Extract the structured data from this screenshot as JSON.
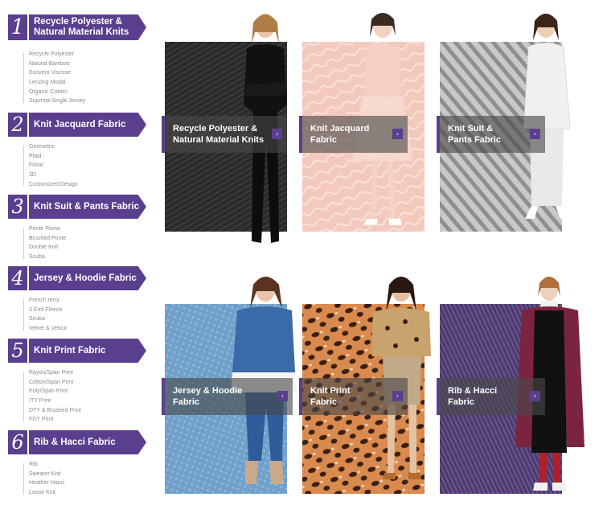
{
  "colors": {
    "accent": "#5a3f8e",
    "caption_bg": "rgba(72,72,72,0.62)"
  },
  "sidebar": {
    "categories": [
      {
        "num": "1",
        "title_line1": "Recycle Polyester &",
        "title_line2": "Natural Material Knits",
        "items": [
          "Recycle Polyester",
          "Natural Bamboo",
          "Ecovero Viscose",
          "Lenzing Modal",
          "Organic Cotton",
          "Suprima Single Jersey"
        ]
      },
      {
        "num": "2",
        "title_line1": "Knit Jacquard Fabric",
        "title_line2": "",
        "items": [
          "Geometric",
          "Plaid",
          "Floral",
          "3D",
          "Customized Design"
        ]
      },
      {
        "num": "3",
        "title_line1": "Knit Suit & Pants Fabric",
        "title_line2": "",
        "items": [
          "Ponte Roma",
          "Brushed Ponte",
          "Double Knit",
          "Scuba"
        ]
      },
      {
        "num": "4",
        "title_line1": "Jersey & Hoodie Fabric",
        "title_line2": "",
        "items": [
          "French terry",
          "3 End Fleece",
          "Scuba",
          "Velvet & Velour"
        ]
      },
      {
        "num": "5",
        "title_line1": "Knit Print Fabric",
        "title_line2": "",
        "items": [
          "Rayon/Span Print",
          "Cotton/Span Print",
          "Poly/Span Print",
          "ITY Print",
          "DTY & Brushed Print",
          "FDY Print"
        ]
      },
      {
        "num": "6",
        "title_line1": "Rib & Hacci Fabric",
        "title_line2": "",
        "items": [
          "Rib",
          "Sweater Knit",
          "Heather Hacci",
          "Loose Knit"
        ]
      }
    ]
  },
  "tiles": [
    {
      "line1": "Recycle Polyester &",
      "line2": "Natural Material Knits",
      "arrow": "›"
    },
    {
      "line1": "Knit Jacquard",
      "line2": "Fabric",
      "arrow": "›"
    },
    {
      "line1": "Knit Suit &",
      "line2": "Pants Fabric",
      "arrow": "›"
    },
    {
      "line1": "Jersey & Hoodie",
      "line2": "Fabric",
      "arrow": "›"
    },
    {
      "line1": "Knit Print",
      "line2": "Fabric",
      "arrow": "›"
    },
    {
      "line1": "Rib & Hacci",
      "line2": "Fabric",
      "arrow": "›"
    }
  ]
}
